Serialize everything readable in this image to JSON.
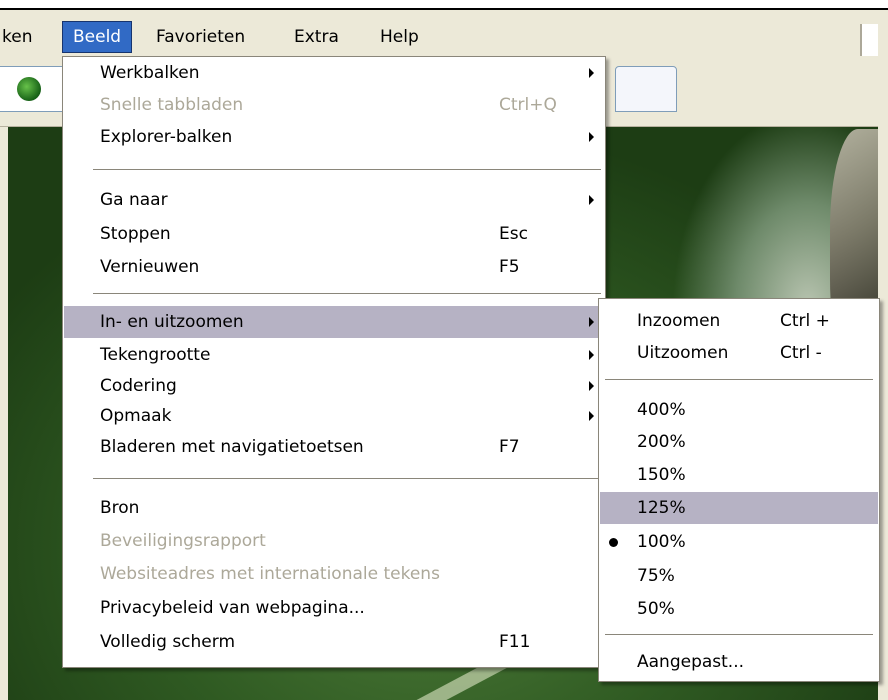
{
  "menubar": {
    "items": [
      {
        "label": "ken"
      },
      {
        "label": "Beeld"
      },
      {
        "label": "Favorieten"
      },
      {
        "label": "Extra"
      },
      {
        "label": "Help"
      }
    ]
  },
  "view_menu": {
    "items": [
      {
        "label": "Werkbalken",
        "shortcut": "",
        "submenu": true,
        "disabled": false
      },
      {
        "label": "Snelle tabbladen",
        "shortcut": "Ctrl+Q",
        "submenu": false,
        "disabled": true
      },
      {
        "label": "Explorer-balken",
        "shortcut": "",
        "submenu": true,
        "disabled": false
      },
      {
        "label": "Ga naar",
        "shortcut": "",
        "submenu": true,
        "disabled": false
      },
      {
        "label": "Stoppen",
        "shortcut": "Esc",
        "submenu": false,
        "disabled": false
      },
      {
        "label": "Vernieuwen",
        "shortcut": "F5",
        "submenu": false,
        "disabled": false
      },
      {
        "label": "In- en uitzoomen",
        "shortcut": "",
        "submenu": true,
        "disabled": false,
        "highlighted": true
      },
      {
        "label": "Tekengrootte",
        "shortcut": "",
        "submenu": true,
        "disabled": false
      },
      {
        "label": "Codering",
        "shortcut": "",
        "submenu": true,
        "disabled": false
      },
      {
        "label": "Opmaak",
        "shortcut": "",
        "submenu": true,
        "disabled": false
      },
      {
        "label": "Bladeren met navigatietoetsen",
        "shortcut": "F7",
        "submenu": false,
        "disabled": false
      },
      {
        "label": "Bron",
        "shortcut": "",
        "submenu": false,
        "disabled": false
      },
      {
        "label": "Beveiligingsrapport",
        "shortcut": "",
        "submenu": false,
        "disabled": true
      },
      {
        "label": "Websiteadres met internationale tekens",
        "shortcut": "",
        "submenu": false,
        "disabled": true
      },
      {
        "label": "Privacybeleid van webpagina...",
        "shortcut": "",
        "submenu": false,
        "disabled": false
      },
      {
        "label": "Volledig scherm",
        "shortcut": "F11",
        "submenu": false,
        "disabled": false
      }
    ]
  },
  "zoom_menu": {
    "items": [
      {
        "label": "Inzoomen",
        "shortcut": "Ctrl +"
      },
      {
        "label": "Uitzoomen",
        "shortcut": "Ctrl -"
      },
      {
        "label": "400%",
        "shortcut": ""
      },
      {
        "label": "200%",
        "shortcut": ""
      },
      {
        "label": "150%",
        "shortcut": ""
      },
      {
        "label": "125%",
        "shortcut": "",
        "highlighted": true
      },
      {
        "label": "100%",
        "shortcut": "",
        "checked": true
      },
      {
        "label": "75%",
        "shortcut": ""
      },
      {
        "label": "50%",
        "shortcut": ""
      },
      {
        "label": "Aangepast...",
        "shortcut": ""
      }
    ]
  },
  "colors": {
    "menu_highlight": "#b6b2c4",
    "menubar_active": "#316ac5",
    "disabled_text": "#aca899"
  }
}
